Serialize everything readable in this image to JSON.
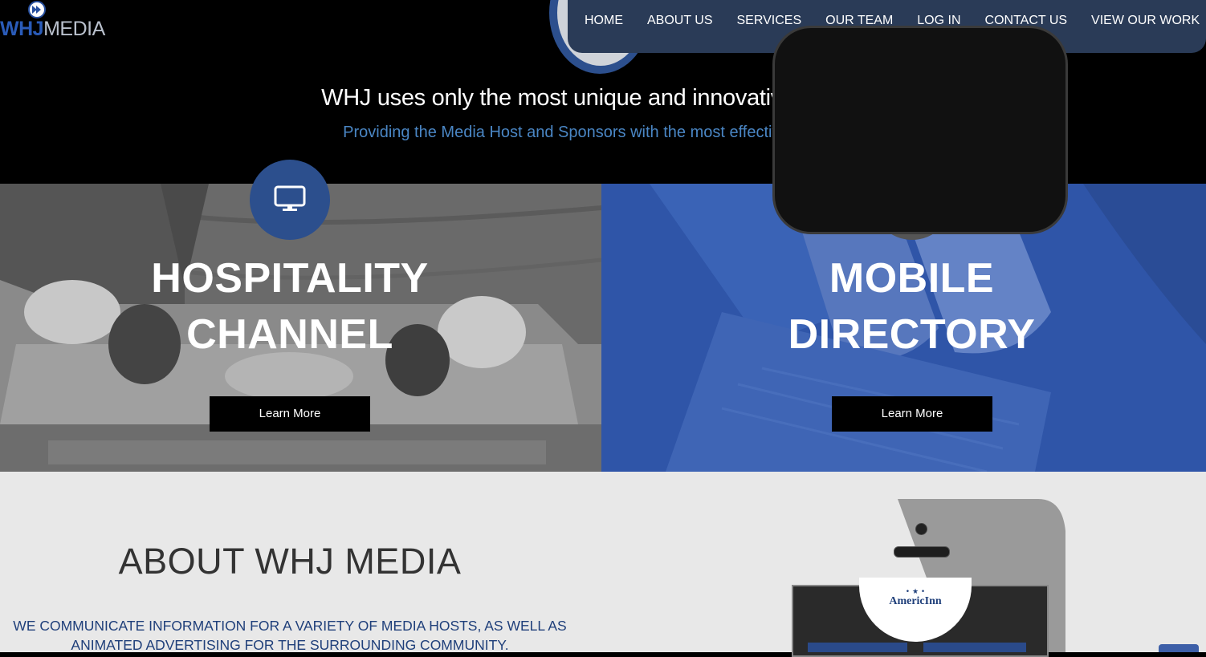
{
  "logo": {
    "primary": "WHJ",
    "secondary": "MEDIA"
  },
  "nav": {
    "items": [
      "HOME",
      "ABOUT US",
      "SERVICES",
      "OUR TEAM",
      "LOG IN",
      "CONTACT US",
      "VIEW OUR WORK"
    ]
  },
  "hero": {
    "title": "WHJ uses only the most unique and innovative systems",
    "subtitle": "Providing the Media Host and Sponsors with the most effective message."
  },
  "services": [
    {
      "icon": "monitor-icon",
      "title_line1": "HOSPITALITY",
      "title_line2": "CHANNEL",
      "button": "Learn More"
    },
    {
      "icon": "mobile-phone-icon",
      "title_line1": "MOBILE",
      "title_line2": "DIRECTORY",
      "button": "Learn More"
    }
  ],
  "about": {
    "title": "ABOUT WHJ MEDIA",
    "text": "WE COMMUNICATE INFORMATION FOR A VARIETY OF MEDIA HOSTS, AS WELL AS ANIMATED ADVERTISING FOR THE SURROUNDING COMMUNITY."
  },
  "phone_screen": {
    "brand": "AmericInn",
    "stars": "• ★ •"
  },
  "colors": {
    "nav_bg": "#2a3b57",
    "accent_blue": "#2c4f8d",
    "subtitle_blue": "#4a86c4",
    "mobile_panel_blue": "#2f55a8",
    "about_text_blue": "#1f3f7a"
  }
}
